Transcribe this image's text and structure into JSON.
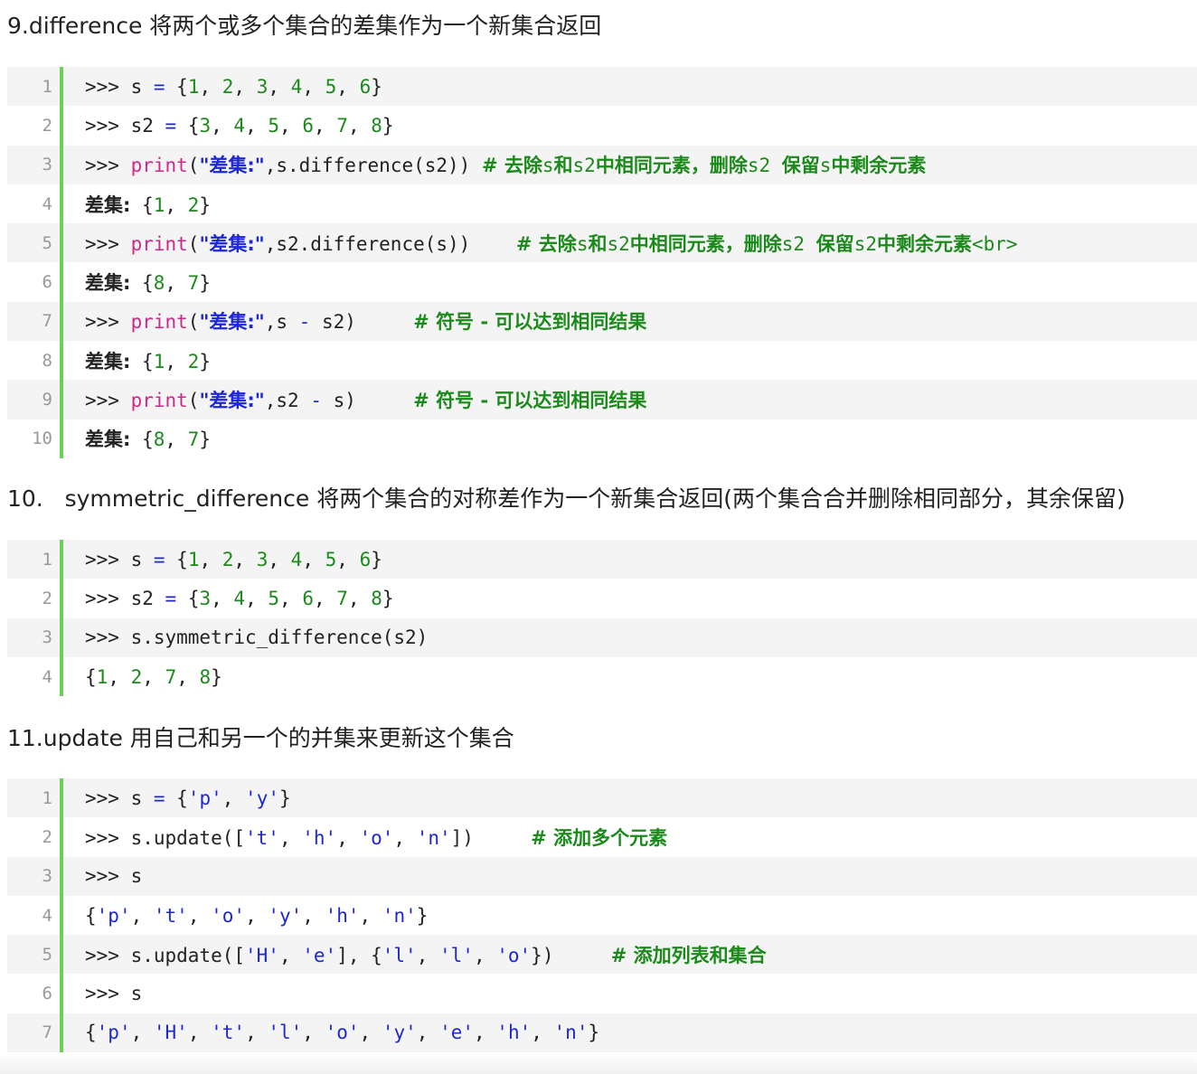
{
  "sections": [
    {
      "heading": "9.difference 将两个或多个集合的差集作为一个新集合返回",
      "lines": [
        {
          "num": "1",
          "tokens": [
            {
              "t": ">>> s ",
              "c": "p"
            },
            {
              "t": "=",
              "c": "o"
            },
            {
              "t": " {",
              "c": "p"
            },
            {
              "t": "1",
              "c": "n"
            },
            {
              "t": ", ",
              "c": "p"
            },
            {
              "t": "2",
              "c": "n"
            },
            {
              "t": ", ",
              "c": "p"
            },
            {
              "t": "3",
              "c": "n"
            },
            {
              "t": ", ",
              "c": "p"
            },
            {
              "t": "4",
              "c": "n"
            },
            {
              "t": ", ",
              "c": "p"
            },
            {
              "t": "5",
              "c": "n"
            },
            {
              "t": ", ",
              "c": "p"
            },
            {
              "t": "6",
              "c": "n"
            },
            {
              "t": "}",
              "c": "p"
            }
          ]
        },
        {
          "num": "2",
          "tokens": [
            {
              "t": ">>> s2 ",
              "c": "p"
            },
            {
              "t": "=",
              "c": "o"
            },
            {
              "t": " {",
              "c": "p"
            },
            {
              "t": "3",
              "c": "n"
            },
            {
              "t": ", ",
              "c": "p"
            },
            {
              "t": "4",
              "c": "n"
            },
            {
              "t": ", ",
              "c": "p"
            },
            {
              "t": "5",
              "c": "n"
            },
            {
              "t": ", ",
              "c": "p"
            },
            {
              "t": "6",
              "c": "n"
            },
            {
              "t": ", ",
              "c": "p"
            },
            {
              "t": "7",
              "c": "n"
            },
            {
              "t": ", ",
              "c": "p"
            },
            {
              "t": "8",
              "c": "n"
            },
            {
              "t": "}",
              "c": "p"
            }
          ]
        },
        {
          "num": "3",
          "tokens": [
            {
              "t": ">>> ",
              "c": "p"
            },
            {
              "t": "print",
              "c": "k"
            },
            {
              "t": "(",
              "c": "p"
            },
            {
              "t": "\"差集:\"",
              "c": "s"
            },
            {
              "t": ",s.difference(s2)) ",
              "c": "p"
            },
            {
              "t": "# 去除",
              "c": "c"
            },
            {
              "t": "s",
              "c": "cm"
            },
            {
              "t": "和",
              "c": "c"
            },
            {
              "t": "s2",
              "c": "cm"
            },
            {
              "t": "中相同元素，删除",
              "c": "c"
            },
            {
              "t": "s2 ",
              "c": "cm"
            },
            {
              "t": "保留",
              "c": "c"
            },
            {
              "t": "s",
              "c": "cm"
            },
            {
              "t": "中剩余元素",
              "c": "c"
            }
          ]
        },
        {
          "num": "4",
          "tokens": [
            {
              "t": "差集:",
              "c": "z"
            },
            {
              "t": " {",
              "c": "p"
            },
            {
              "t": "1",
              "c": "n"
            },
            {
              "t": ", ",
              "c": "p"
            },
            {
              "t": "2",
              "c": "n"
            },
            {
              "t": "}",
              "c": "p"
            }
          ]
        },
        {
          "num": "5",
          "tokens": [
            {
              "t": ">>> ",
              "c": "p"
            },
            {
              "t": "print",
              "c": "k"
            },
            {
              "t": "(",
              "c": "p"
            },
            {
              "t": "\"差集:\"",
              "c": "s"
            },
            {
              "t": ",s2.difference(s))    ",
              "c": "p"
            },
            {
              "t": "# 去除",
              "c": "c"
            },
            {
              "t": "s",
              "c": "cm"
            },
            {
              "t": "和",
              "c": "c"
            },
            {
              "t": "s2",
              "c": "cm"
            },
            {
              "t": "中相同元素，删除",
              "c": "c"
            },
            {
              "t": "s2 ",
              "c": "cm"
            },
            {
              "t": "保留",
              "c": "c"
            },
            {
              "t": "s2",
              "c": "cm"
            },
            {
              "t": "中剩余元素",
              "c": "c"
            },
            {
              "t": "<br>",
              "c": "cm"
            }
          ]
        },
        {
          "num": "6",
          "tokens": [
            {
              "t": "差集:",
              "c": "z"
            },
            {
              "t": " {",
              "c": "p"
            },
            {
              "t": "8",
              "c": "n"
            },
            {
              "t": ", ",
              "c": "p"
            },
            {
              "t": "7",
              "c": "n"
            },
            {
              "t": "}",
              "c": "p"
            }
          ]
        },
        {
          "num": "7",
          "tokens": [
            {
              "t": ">>> ",
              "c": "p"
            },
            {
              "t": "print",
              "c": "k"
            },
            {
              "t": "(",
              "c": "p"
            },
            {
              "t": "\"差集:\"",
              "c": "s"
            },
            {
              "t": ",s ",
              "c": "p"
            },
            {
              "t": "-",
              "c": "o"
            },
            {
              "t": " s2)     ",
              "c": "p"
            },
            {
              "t": "# 符号 - 可以达到相同结果",
              "c": "c"
            }
          ]
        },
        {
          "num": "8",
          "tokens": [
            {
              "t": "差集:",
              "c": "z"
            },
            {
              "t": " {",
              "c": "p"
            },
            {
              "t": "1",
              "c": "n"
            },
            {
              "t": ", ",
              "c": "p"
            },
            {
              "t": "2",
              "c": "n"
            },
            {
              "t": "}",
              "c": "p"
            }
          ]
        },
        {
          "num": "9",
          "tokens": [
            {
              "t": ">>> ",
              "c": "p"
            },
            {
              "t": "print",
              "c": "k"
            },
            {
              "t": "(",
              "c": "p"
            },
            {
              "t": "\"差集:\"",
              "c": "s"
            },
            {
              "t": ",s2 ",
              "c": "p"
            },
            {
              "t": "-",
              "c": "o"
            },
            {
              "t": " s)     ",
              "c": "p"
            },
            {
              "t": "# 符号 - 可以达到相同结果",
              "c": "c"
            }
          ]
        },
        {
          "num": "10",
          "tokens": [
            {
              "t": "差集:",
              "c": "z"
            },
            {
              "t": " {",
              "c": "p"
            },
            {
              "t": "8",
              "c": "n"
            },
            {
              "t": ", ",
              "c": "p"
            },
            {
              "t": "7",
              "c": "n"
            },
            {
              "t": "}",
              "c": "p"
            }
          ]
        }
      ]
    },
    {
      "heading": "10.   symmetric_difference 将两个集合的对称差作为一个新集合返回(两个集合合并删除相同部分，其余保留)",
      "lines": [
        {
          "num": "1",
          "tokens": [
            {
              "t": ">>> s ",
              "c": "p"
            },
            {
              "t": "=",
              "c": "o"
            },
            {
              "t": " {",
              "c": "p"
            },
            {
              "t": "1",
              "c": "n"
            },
            {
              "t": ", ",
              "c": "p"
            },
            {
              "t": "2",
              "c": "n"
            },
            {
              "t": ", ",
              "c": "p"
            },
            {
              "t": "3",
              "c": "n"
            },
            {
              "t": ", ",
              "c": "p"
            },
            {
              "t": "4",
              "c": "n"
            },
            {
              "t": ", ",
              "c": "p"
            },
            {
              "t": "5",
              "c": "n"
            },
            {
              "t": ", ",
              "c": "p"
            },
            {
              "t": "6",
              "c": "n"
            },
            {
              "t": "}",
              "c": "p"
            }
          ]
        },
        {
          "num": "2",
          "tokens": [
            {
              "t": ">>> s2 ",
              "c": "p"
            },
            {
              "t": "=",
              "c": "o"
            },
            {
              "t": " {",
              "c": "p"
            },
            {
              "t": "3",
              "c": "n"
            },
            {
              "t": ", ",
              "c": "p"
            },
            {
              "t": "4",
              "c": "n"
            },
            {
              "t": ", ",
              "c": "p"
            },
            {
              "t": "5",
              "c": "n"
            },
            {
              "t": ", ",
              "c": "p"
            },
            {
              "t": "6",
              "c": "n"
            },
            {
              "t": ", ",
              "c": "p"
            },
            {
              "t": "7",
              "c": "n"
            },
            {
              "t": ", ",
              "c": "p"
            },
            {
              "t": "8",
              "c": "n"
            },
            {
              "t": "}",
              "c": "p"
            }
          ]
        },
        {
          "num": "3",
          "tokens": [
            {
              "t": ">>> s.symmetric_difference(s2)",
              "c": "p"
            }
          ]
        },
        {
          "num": "4",
          "tokens": [
            {
              "t": "{",
              "c": "p"
            },
            {
              "t": "1",
              "c": "n"
            },
            {
              "t": ", ",
              "c": "p"
            },
            {
              "t": "2",
              "c": "n"
            },
            {
              "t": ", ",
              "c": "p"
            },
            {
              "t": "7",
              "c": "n"
            },
            {
              "t": ", ",
              "c": "p"
            },
            {
              "t": "8",
              "c": "n"
            },
            {
              "t": "}",
              "c": "p"
            }
          ]
        }
      ]
    },
    {
      "heading": "11.update 用自己和另一个的并集来更新这个集合",
      "lines": [
        {
          "num": "1",
          "tokens": [
            {
              "t": ">>> s ",
              "c": "p"
            },
            {
              "t": "=",
              "c": "o"
            },
            {
              "t": " {",
              "c": "p"
            },
            {
              "t": "'p'",
              "c": "sq"
            },
            {
              "t": ", ",
              "c": "p"
            },
            {
              "t": "'y'",
              "c": "sq"
            },
            {
              "t": "}",
              "c": "p"
            }
          ]
        },
        {
          "num": "2",
          "tokens": [
            {
              "t": ">>> s.update([",
              "c": "p"
            },
            {
              "t": "'t'",
              "c": "sq"
            },
            {
              "t": ", ",
              "c": "p"
            },
            {
              "t": "'h'",
              "c": "sq"
            },
            {
              "t": ", ",
              "c": "p"
            },
            {
              "t": "'o'",
              "c": "sq"
            },
            {
              "t": ", ",
              "c": "p"
            },
            {
              "t": "'n'",
              "c": "sq"
            },
            {
              "t": "])     ",
              "c": "p"
            },
            {
              "t": "# 添加多个元素",
              "c": "c"
            }
          ]
        },
        {
          "num": "3",
          "tokens": [
            {
              "t": ">>> s",
              "c": "p"
            }
          ]
        },
        {
          "num": "4",
          "tokens": [
            {
              "t": "{",
              "c": "p"
            },
            {
              "t": "'p'",
              "c": "sq"
            },
            {
              "t": ", ",
              "c": "p"
            },
            {
              "t": "'t'",
              "c": "sq"
            },
            {
              "t": ", ",
              "c": "p"
            },
            {
              "t": "'o'",
              "c": "sq"
            },
            {
              "t": ", ",
              "c": "p"
            },
            {
              "t": "'y'",
              "c": "sq"
            },
            {
              "t": ", ",
              "c": "p"
            },
            {
              "t": "'h'",
              "c": "sq"
            },
            {
              "t": ", ",
              "c": "p"
            },
            {
              "t": "'n'",
              "c": "sq"
            },
            {
              "t": "}",
              "c": "p"
            }
          ]
        },
        {
          "num": "5",
          "tokens": [
            {
              "t": ">>> s.update([",
              "c": "p"
            },
            {
              "t": "'H'",
              "c": "sq"
            },
            {
              "t": ", ",
              "c": "p"
            },
            {
              "t": "'e'",
              "c": "sq"
            },
            {
              "t": "], {",
              "c": "p"
            },
            {
              "t": "'l'",
              "c": "sq"
            },
            {
              "t": ", ",
              "c": "p"
            },
            {
              "t": "'l'",
              "c": "sq"
            },
            {
              "t": ", ",
              "c": "p"
            },
            {
              "t": "'o'",
              "c": "sq"
            },
            {
              "t": "})     ",
              "c": "p"
            },
            {
              "t": "# 添加列表和集合",
              "c": "c"
            }
          ]
        },
        {
          "num": "6",
          "tokens": [
            {
              "t": ">>> s",
              "c": "p"
            }
          ]
        },
        {
          "num": "7",
          "tokens": [
            {
              "t": "{",
              "c": "p"
            },
            {
              "t": "'p'",
              "c": "sq"
            },
            {
              "t": ", ",
              "c": "p"
            },
            {
              "t": "'H'",
              "c": "sq"
            },
            {
              "t": ", ",
              "c": "p"
            },
            {
              "t": "'t'",
              "c": "sq"
            },
            {
              "t": ", ",
              "c": "p"
            },
            {
              "t": "'l'",
              "c": "sq"
            },
            {
              "t": ", ",
              "c": "p"
            },
            {
              "t": "'o'",
              "c": "sq"
            },
            {
              "t": ", ",
              "c": "p"
            },
            {
              "t": "'y'",
              "c": "sq"
            },
            {
              "t": ", ",
              "c": "p"
            },
            {
              "t": "'e'",
              "c": "sq"
            },
            {
              "t": ", ",
              "c": "p"
            },
            {
              "t": "'h'",
              "c": "sq"
            },
            {
              "t": ", ",
              "c": "p"
            },
            {
              "t": "'n'",
              "c": "sq"
            },
            {
              "t": "}",
              "c": "p"
            }
          ]
        }
      ]
    }
  ],
  "colors": {
    "gutter_bar": "#6ccf5a",
    "keyword": "#d0278a",
    "string": "#1d27d6",
    "number": "#1b8a1b",
    "comment": "#1b8a1b",
    "row_alt_bg": "#f4f4f4"
  }
}
